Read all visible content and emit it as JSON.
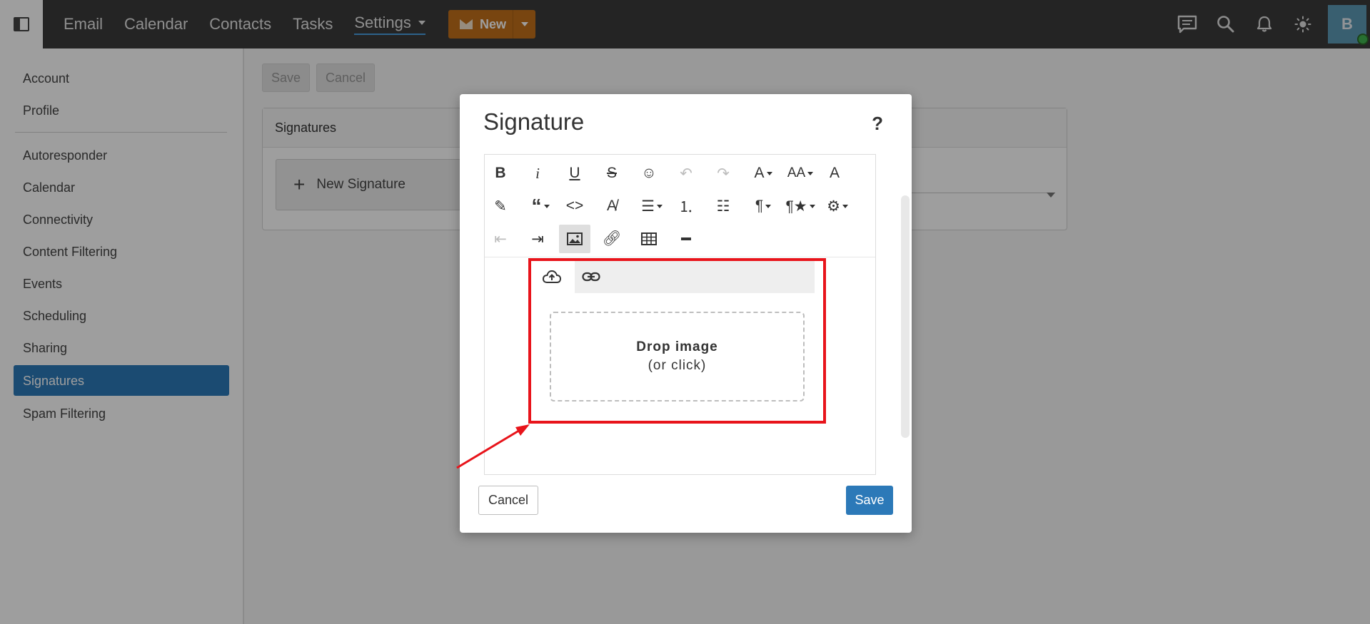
{
  "nav": {
    "items": [
      "Email",
      "Calendar",
      "Contacts",
      "Tasks"
    ],
    "settings_label": "Settings",
    "new_label": "New"
  },
  "user": {
    "avatar_initial": "B"
  },
  "sidebar": {
    "items": [
      "Account",
      "Profile",
      "Autoresponder",
      "Calendar",
      "Connectivity",
      "Content Filtering",
      "Events",
      "Scheduling",
      "Sharing",
      "Signatures",
      "Spam Filtering"
    ],
    "active": "Signatures"
  },
  "main": {
    "save_label": "Save",
    "cancel_label": "Cancel",
    "panel_title": "Signatures",
    "new_signature_label": "New Signature"
  },
  "modal": {
    "title": "Signature",
    "help": "?",
    "dropzone_title": "Drop image",
    "dropzone_sub": "(or click)",
    "cancel_label": "Cancel",
    "save_label": "Save"
  },
  "colors": {
    "topbar": "#3b3b3b",
    "accent": "#2c79b8",
    "new_button": "#c2701b",
    "highlight": "#e8141b"
  }
}
